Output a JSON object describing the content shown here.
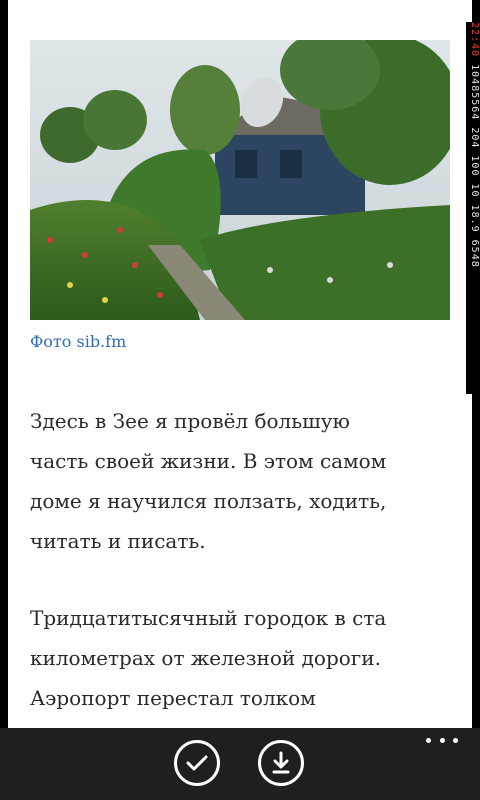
{
  "article": {
    "photo_caption": "Фото sib.fm",
    "paragraph1": [
      "Здесь в Зее я провёл большую",
      "часть своей жизни. В этом самом",
      "доме я научился ползать, ходить,",
      "читать и писать."
    ],
    "paragraph2": [
      "Тридцатитысячный городок в ста",
      "километрах от железной дороги.",
      "Аэропорт перестал толком"
    ]
  },
  "status_strip": {
    "text_red": "22:40",
    "text": "10485564 204 100 10 18.9 6548"
  },
  "app_bar": {
    "icons": [
      "check-icon",
      "download-icon",
      "more-icon"
    ]
  },
  "colors": {
    "caption_link": "#2f6db5",
    "app_bar_bg": "#1f1f1f",
    "page_bg": "#ffffff"
  }
}
